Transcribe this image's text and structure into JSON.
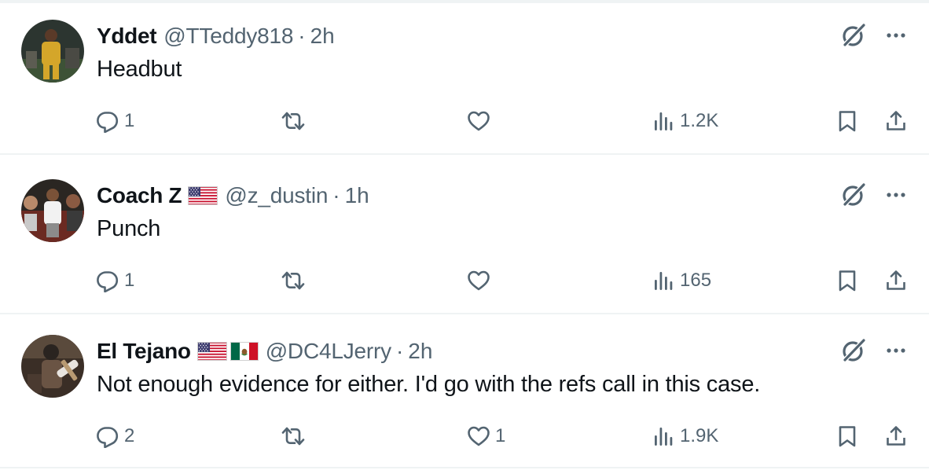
{
  "tweets": [
    {
      "name": "Coach Z",
      "flags": [
        "us-flag"
      ],
      "handle": "@z_dustin",
      "separator": "·",
      "time": "1h",
      "text": "Punch",
      "replies": "1",
      "retweets": "",
      "likes": "",
      "views": "165"
    },
    {
      "name": "El Tejano",
      "flags": [
        "us-flag",
        "mexico-flag"
      ],
      "handle": "@DC4LJerry",
      "separator": "·",
      "time": "2h",
      "text": "Not enough evidence for either. I'd go with the refs call in this case.",
      "replies": "2",
      "retweets": "",
      "likes": "1",
      "views": "1.9K"
    },
    {
      "name": "Yddet",
      "flags": [],
      "handle": "@TTeddy818",
      "separator": "·",
      "time": "2h",
      "text": "Headbut",
      "replies": "1",
      "retweets": "",
      "likes": "",
      "views": "1.2K"
    }
  ],
  "colors": {
    "text_primary": "#0f1419",
    "text_secondary": "#536471",
    "divider": "#eff3f4"
  },
  "icons": [
    "grok-icon",
    "more-icon",
    "reply-icon",
    "retweet-icon",
    "like-icon",
    "views-icon",
    "bookmark-icon",
    "share-icon"
  ]
}
